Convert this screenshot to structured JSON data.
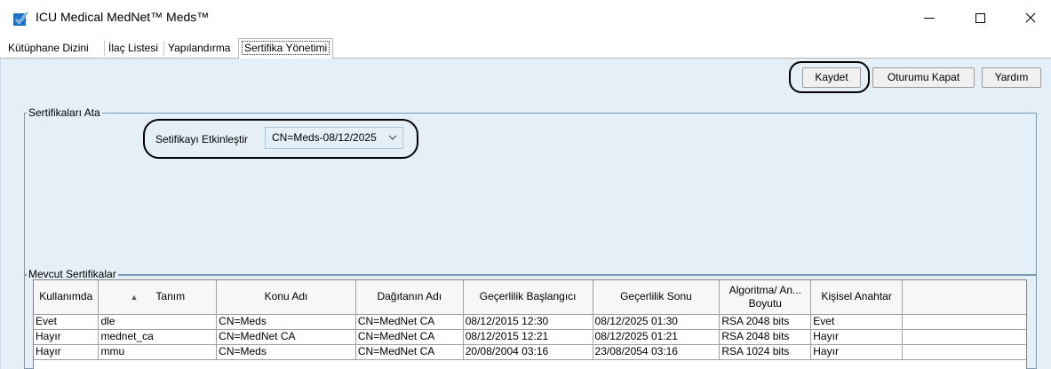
{
  "window": {
    "title": "ICU Medical MedNet™ Meds™",
    "icon": "checkmark-icon",
    "accent_color": "#1a73c9"
  },
  "tabs": [
    {
      "label": "Kütüphane Dizini",
      "active": false
    },
    {
      "label": "İlaç Listesi",
      "active": false
    },
    {
      "label": "Yapılandırma",
      "active": false
    },
    {
      "label": "Sertifika Yönetimi",
      "active": true
    }
  ],
  "toolbar": {
    "save_label": "Kaydet",
    "logout_label": "Oturumu Kapat",
    "help_label": "Yardım"
  },
  "assign_section": {
    "title": "Sertifikaları Ata",
    "activate_label": "Setifikayı Etkinleştir",
    "selected_certificate": "CN=Meds-08/12/2025"
  },
  "current_section": {
    "title": "Mevcut Sertifikalar",
    "columns": [
      "Kullanımda",
      "Tanım",
      "Konu Adı",
      "Dağıtanın Adı",
      "Geçerlilik Başlangıcı",
      "Geçerlilik Sonu",
      "Algoritma/ An... Boyutu",
      "Kişisel Anahtar"
    ],
    "rows": [
      [
        "Evet",
        "dle",
        "CN=Meds",
        "CN=MedNet CA",
        "08/12/2015 12:30",
        "08/12/2025 01:30",
        "RSA 2048 bits",
        "Evet"
      ],
      [
        "Hayır",
        "mednet_ca",
        "CN=MedNet CA",
        "CN=MedNet CA",
        "08/12/2015 12:21",
        "08/12/2025 01:21",
        "RSA 2048 bits",
        "Hayır"
      ],
      [
        "Hayır",
        "mmu",
        "CN=Meds",
        "CN=MedNet CA",
        "20/08/2004 03:16",
        "23/08/2054 03:16",
        "RSA 1024 bits",
        "Hayır"
      ]
    ]
  },
  "colors": {
    "content_background": "#e4eff7",
    "group_border": "#7a9ab8"
  }
}
